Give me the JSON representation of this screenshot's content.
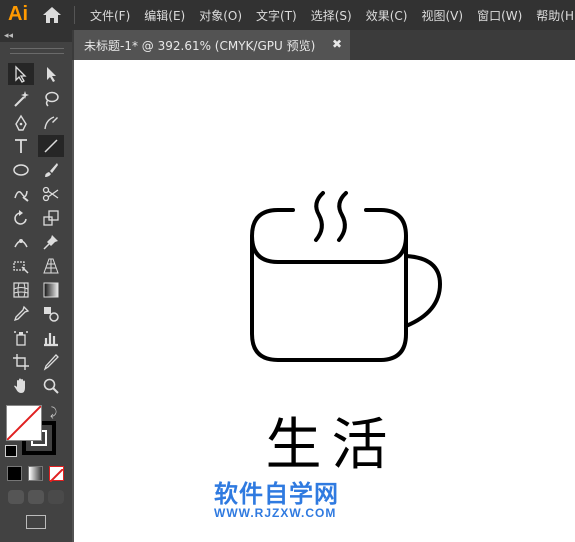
{
  "app": {
    "logo": "Ai"
  },
  "menu": [
    "文件(F)",
    "编辑(E)",
    "对象(O)",
    "文字(T)",
    "选择(S)",
    "效果(C)",
    "视图(V)",
    "窗口(W)",
    "帮助(H)"
  ],
  "panel": {
    "collapse": "◂◂"
  },
  "tab": {
    "title": "未标题-1* @ 392.61% (CMYK/GPU 预览)",
    "close": "✖"
  },
  "canvas": {
    "text": "生活",
    "watermark_main": "软件自学网",
    "watermark_sub": "WWW.RJZXW.COM"
  },
  "colors": {
    "accent": "#ff9a00",
    "watermark": "#2f7ae0",
    "canvas": "#ffffff",
    "ui_dark": "#323232"
  },
  "tools": [
    "selection-tool",
    "direct-selection-tool",
    "magic-wand-tool",
    "lasso-tool",
    "pen-tool",
    "curvature-tool",
    "type-tool",
    "line-segment-tool",
    "ellipse-tool",
    "paintbrush-tool",
    "shaper-tool",
    "scissors-tool",
    "rotate-tool",
    "scale-tool",
    "puppet-warp-tool",
    "pin-tool",
    "free-transform-tool",
    "perspective-grid-tool",
    "mesh-tool",
    "gradient-tool",
    "eyedropper-tool",
    "blend-tool",
    "symbol-sprayer-tool",
    "column-graph-tool",
    "artboard-tool",
    "slice-tool",
    "hand-tool",
    "zoom-tool"
  ]
}
